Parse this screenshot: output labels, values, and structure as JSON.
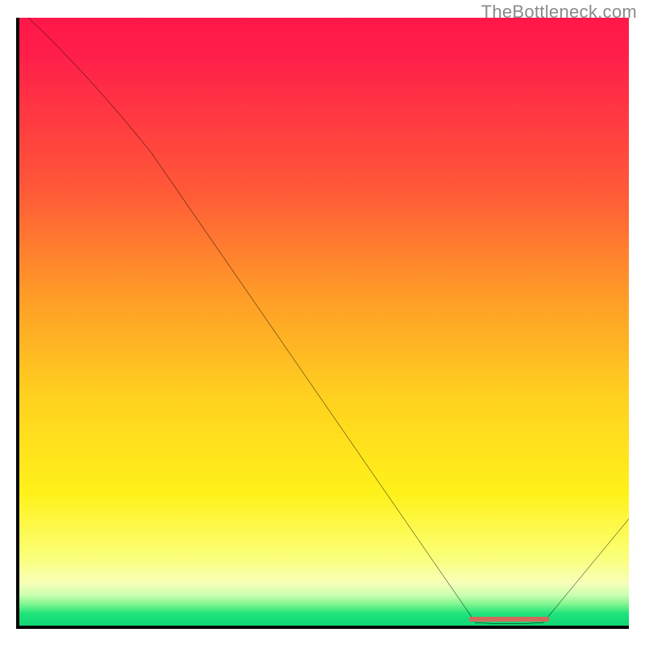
{
  "attribution": "TheBottleneck.com",
  "chart_data": {
    "type": "line",
    "title": "",
    "xlabel": "",
    "ylabel": "",
    "xlim": [
      0,
      100
    ],
    "ylim": [
      0,
      100
    ],
    "series": [
      {
        "name": "bottleneck-curve",
        "x": [
          2,
          22,
          75,
          86,
          100
        ],
        "y": [
          100,
          78,
          1,
          1,
          18
        ]
      }
    ],
    "annotations": [
      {
        "name": "optimal-range-marker",
        "x0": 74,
        "x1": 87,
        "y": 1.2
      }
    ],
    "gradient_stops": [
      {
        "pct": 0,
        "color": "#ff1749"
      },
      {
        "pct": 28,
        "color": "#ff5838"
      },
      {
        "pct": 62,
        "color": "#ffd11f"
      },
      {
        "pct": 88,
        "color": "#fbff76"
      },
      {
        "pct": 96,
        "color": "#7cf58e"
      },
      {
        "pct": 100,
        "color": "#0fd375"
      }
    ]
  }
}
